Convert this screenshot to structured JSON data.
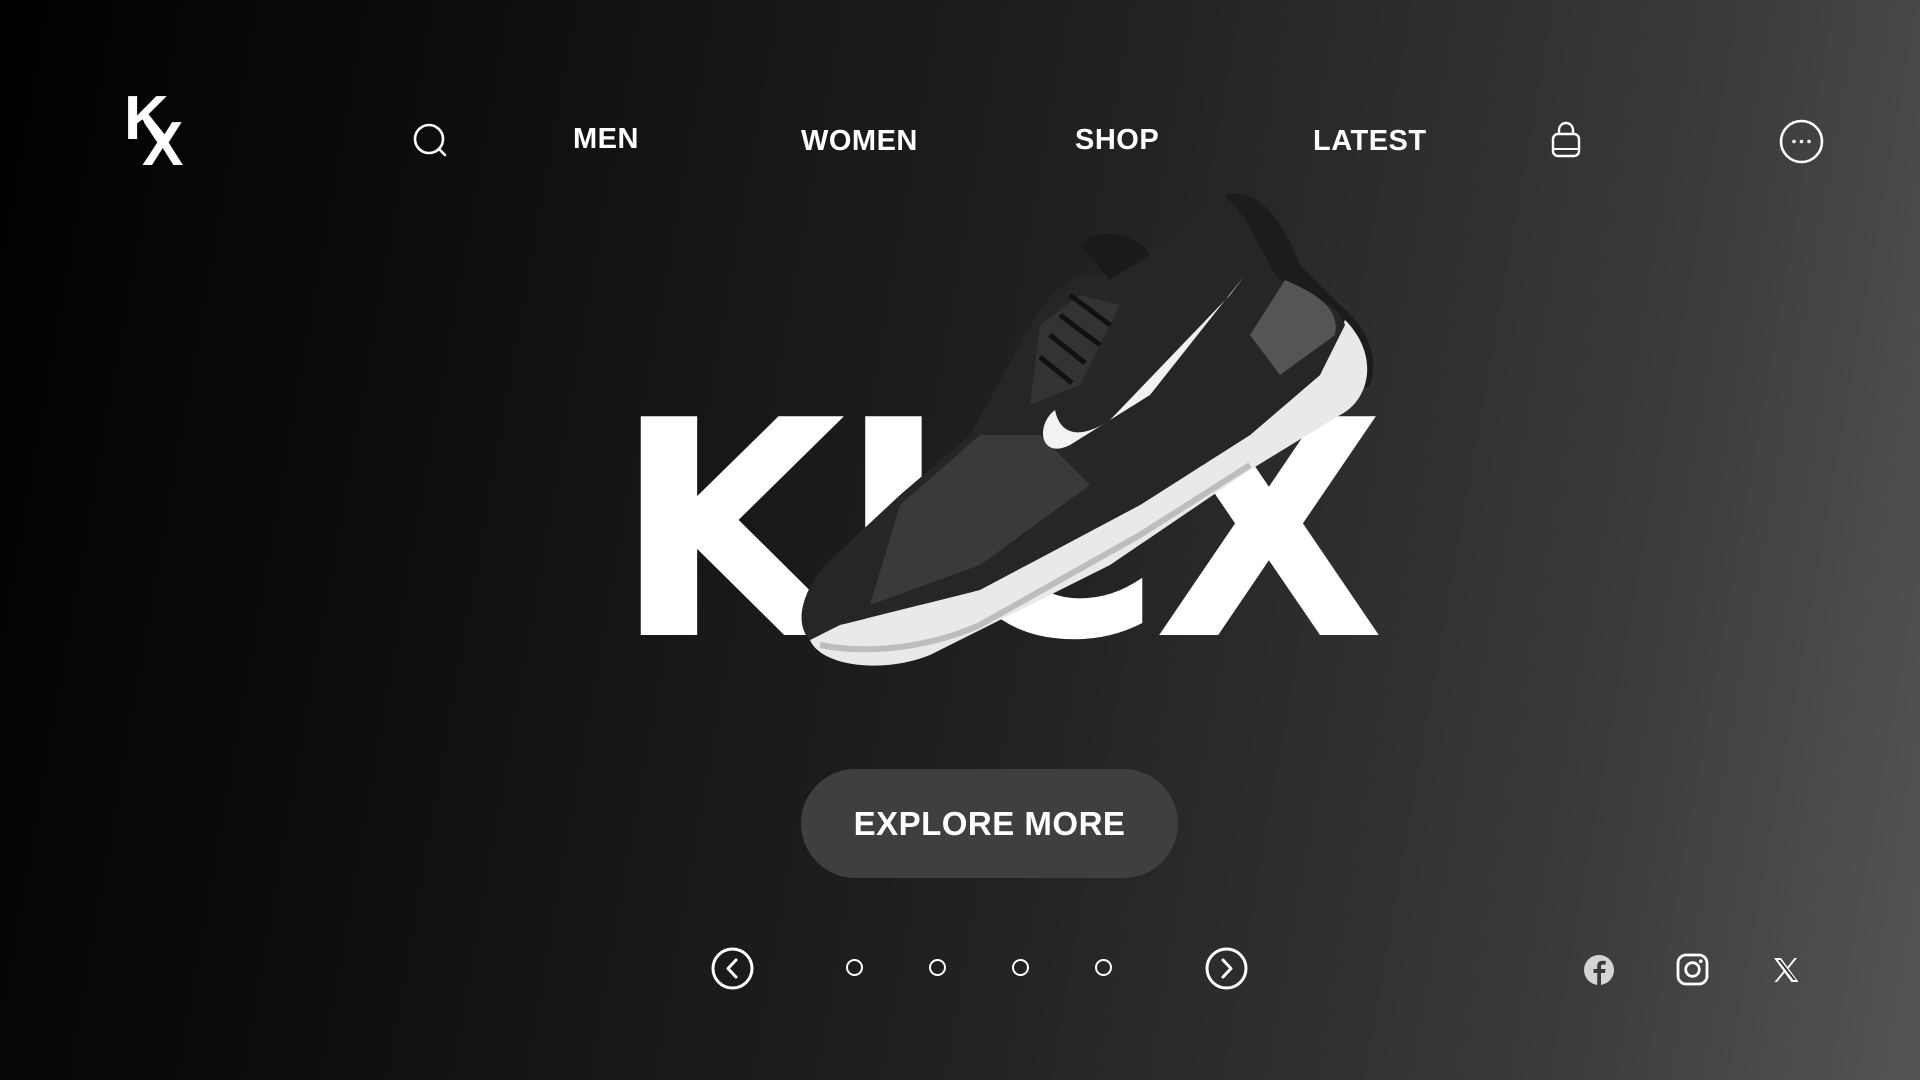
{
  "brand": {
    "logo_top": "K",
    "logo_bottom": "X"
  },
  "nav": {
    "items": [
      {
        "label": "MEN"
      },
      {
        "label": "WOMEN"
      },
      {
        "label": "SHOP"
      },
      {
        "label": "LATEST"
      }
    ],
    "search_icon": "search-icon",
    "bag_icon": "shopping-bag-icon",
    "more_icon": "more-options-icon"
  },
  "hero": {
    "title": "KICX",
    "shoe_image": "running-sneaker-image",
    "cta_label": "EXPLORE MORE"
  },
  "carousel": {
    "prev_icon": "chevron-left-icon",
    "next_icon": "chevron-right-icon",
    "slide_count": 4
  },
  "social": {
    "icons": [
      "facebook-icon",
      "instagram-icon",
      "x-twitter-icon"
    ]
  },
  "colors": {
    "background_start": "#000000",
    "background_end": "#555555",
    "text": "#ffffff",
    "button": "#3f3f3f"
  }
}
